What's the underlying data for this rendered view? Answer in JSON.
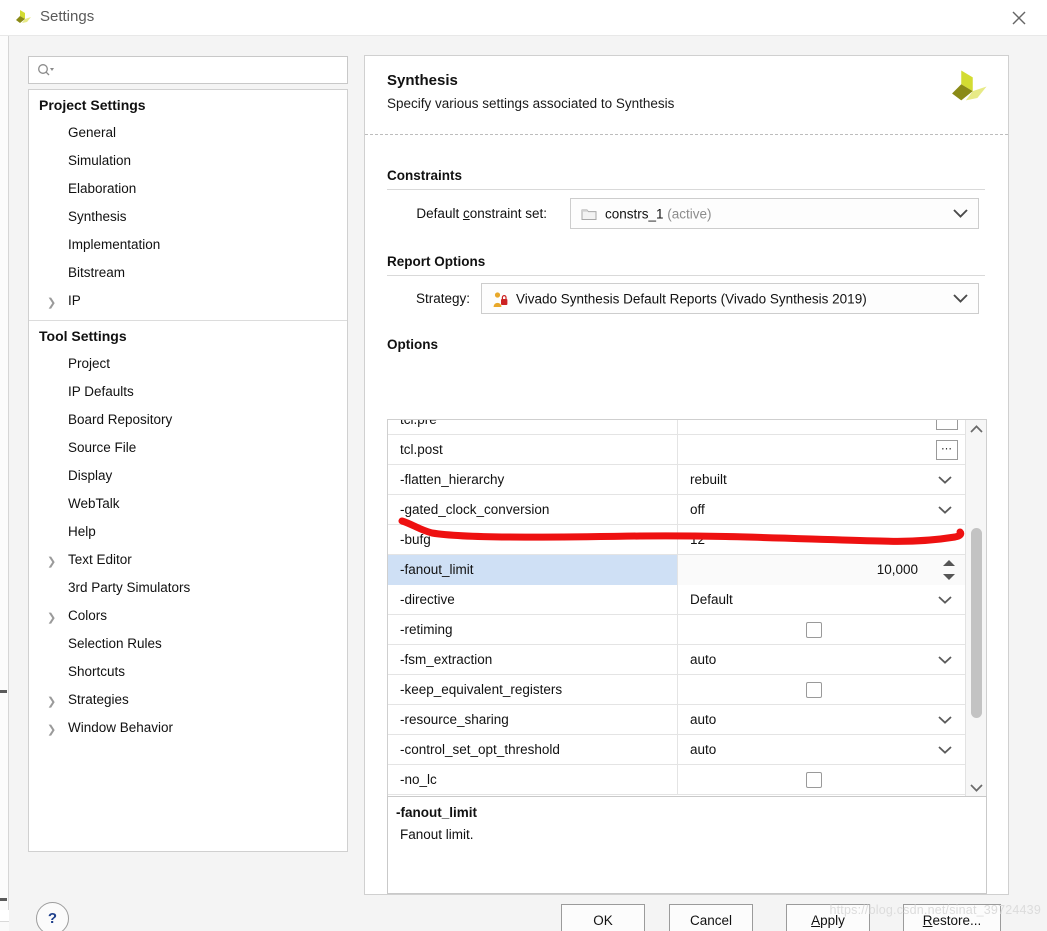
{
  "window": {
    "title": "Settings",
    "app_logo": "vivado-logo-icon",
    "close_icon": "close-icon"
  },
  "sidebar": {
    "search": {
      "placeholder": "",
      "value": "",
      "icon": "search-icon"
    },
    "groups": [
      {
        "title": "Project Settings",
        "items": [
          {
            "label": "General",
            "expandable": false
          },
          {
            "label": "Simulation",
            "expandable": false
          },
          {
            "label": "Elaboration",
            "expandable": false
          },
          {
            "label": "Synthesis",
            "expandable": false
          },
          {
            "label": "Implementation",
            "expandable": false
          },
          {
            "label": "Bitstream",
            "expandable": false
          },
          {
            "label": "IP",
            "expandable": true
          }
        ]
      },
      {
        "title": "Tool Settings",
        "items": [
          {
            "label": "Project",
            "expandable": false
          },
          {
            "label": "IP Defaults",
            "expandable": false
          },
          {
            "label": "Board Repository",
            "expandable": false
          },
          {
            "label": "Source File",
            "expandable": false
          },
          {
            "label": "Display",
            "expandable": false
          },
          {
            "label": "WebTalk",
            "expandable": false
          },
          {
            "label": "Help",
            "expandable": false
          },
          {
            "label": "Text Editor",
            "expandable": true
          },
          {
            "label": "3rd Party Simulators",
            "expandable": false
          },
          {
            "label": "Colors",
            "expandable": true
          },
          {
            "label": "Selection Rules",
            "expandable": false
          },
          {
            "label": "Shortcuts",
            "expandable": false
          },
          {
            "label": "Strategies",
            "expandable": true
          },
          {
            "label": "Window Behavior",
            "expandable": true
          }
        ]
      }
    ]
  },
  "panel": {
    "title": "Synthesis",
    "subtitle": "Specify various settings associated to Synthesis",
    "logo": "vivado-logo-icon",
    "constraints": {
      "heading": "Constraints",
      "field_label": "Default constraint set:",
      "value": "constrs_1",
      "value_suffix": "(active)",
      "icon": "folder-icon"
    },
    "report_options": {
      "heading": "Report Options",
      "field_label": "Strategy:",
      "value": "Vivado Synthesis Default Reports (Vivado Synthesis 2019)",
      "icon": "strategy-lock-icon"
    },
    "options": {
      "heading": "Options",
      "rows": [
        {
          "name": "tcl.pre",
          "value": "",
          "control": "dots",
          "selected": false
        },
        {
          "name": "tcl.post",
          "value": "",
          "control": "dots",
          "selected": false
        },
        {
          "name": "-flatten_hierarchy",
          "value": "rebuilt",
          "control": "dropdown",
          "selected": false
        },
        {
          "name": "-gated_clock_conversion",
          "value": "off",
          "control": "dropdown",
          "selected": false
        },
        {
          "name": "-bufg",
          "value": "12",
          "control": "text",
          "selected": false
        },
        {
          "name": "-fanout_limit",
          "value": "10,000",
          "control": "spinner",
          "selected": true
        },
        {
          "name": "-directive",
          "value": "Default",
          "control": "dropdown",
          "selected": false
        },
        {
          "name": "-retiming",
          "value": "",
          "control": "checkbox",
          "selected": false
        },
        {
          "name": "-fsm_extraction",
          "value": "auto",
          "control": "dropdown",
          "selected": false
        },
        {
          "name": "-keep_equivalent_registers",
          "value": "",
          "control": "checkbox",
          "selected": false
        },
        {
          "name": "-resource_sharing",
          "value": "auto",
          "control": "dropdown",
          "selected": false
        },
        {
          "name": "-control_set_opt_threshold",
          "value": "auto",
          "control": "dropdown",
          "selected": false
        },
        {
          "name": "-no_lc",
          "value": "",
          "control": "checkbox",
          "selected": false
        }
      ]
    },
    "description": {
      "title": "-fanout_limit",
      "text": "Fanout limit."
    }
  },
  "footer": {
    "help_label": "?",
    "buttons": [
      {
        "label": "OK"
      },
      {
        "label": "Cancel"
      },
      {
        "label": "Apply"
      },
      {
        "label": "Restore..."
      }
    ]
  },
  "watermark": {
    "text": "https://blog.csdn.net/sinat_39724439"
  },
  "annotation": {
    "color": "#ee1111",
    "shape": "horizontal-scribble-underline"
  }
}
